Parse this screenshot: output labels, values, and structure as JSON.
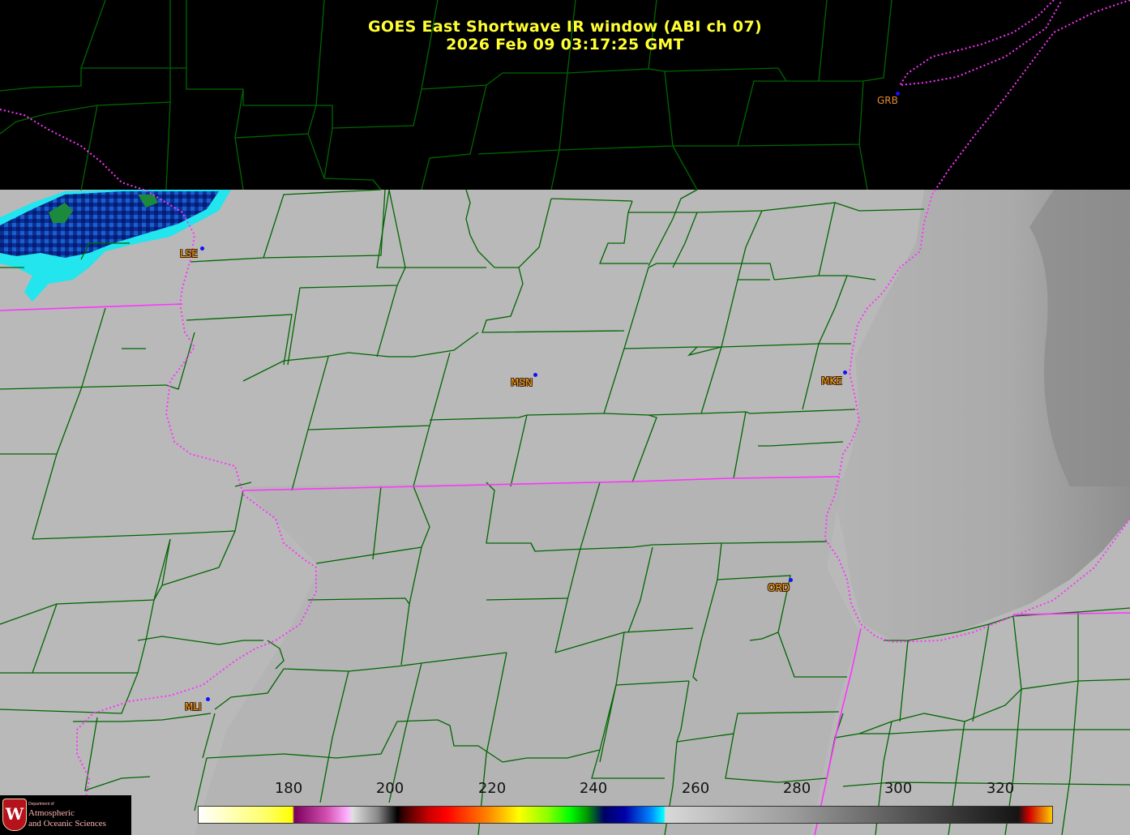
{
  "header": {
    "title_line1": "GOES East Shortwave IR window (ABI ch 07)",
    "title_line2": "2026 Feb 09  03:17:25 GMT"
  },
  "stations": [
    {
      "id": "GRB",
      "label": "GRB",
      "style": "plain"
    },
    {
      "id": "LSE",
      "label": "LSE",
      "style": "outlined"
    },
    {
      "id": "MSN",
      "label": "MSN",
      "style": "outlined"
    },
    {
      "id": "MKE",
      "label": "MKE",
      "style": "outlined"
    },
    {
      "id": "ORD",
      "label": "ORD",
      "style": "outlined"
    },
    {
      "id": "MLI",
      "label": "MLI",
      "style": "outlined"
    }
  ],
  "colorbar": {
    "ticks": [
      "180",
      "200",
      "220",
      "240",
      "260",
      "280",
      "300",
      "320"
    ]
  },
  "logo": {
    "crest_letter": "W",
    "dept_small": "Department of",
    "line1": "Atmospheric",
    "line2": "and Oceanic Sciences"
  },
  "colors": {
    "title": "#ffff33",
    "county_lines": "#006600",
    "state_lines": "#ff33ff",
    "station_dot": "#1010ff",
    "station_label": "#f5a623",
    "imagery_gray": "#b8b8b8"
  }
}
